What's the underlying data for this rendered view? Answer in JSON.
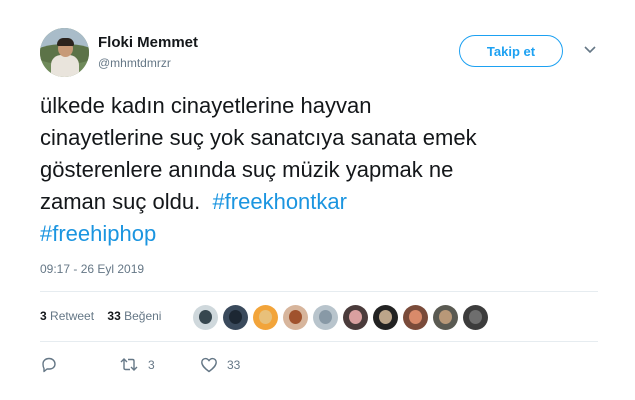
{
  "user": {
    "name": "Floki Memmet",
    "handle": "@mhmtdmrzr"
  },
  "follow_button": {
    "label": "Takip et"
  },
  "tweet": {
    "text_lines": [
      "ülkede kadın cinayetlerine hayvan",
      "cinayetlerine suç yok sanatcıya sanata emek",
      "gösterenlere anında suç müzik yapmak ne",
      "zaman suç oldu. "
    ],
    "hashtags": [
      "#freekhontkar",
      "#freehiphop"
    ],
    "timestamp": "09:17 - 26 Eyl 2019"
  },
  "stats": {
    "retweet_count": "3",
    "retweet_label": "Retweet",
    "like_count": "33",
    "like_label": "Beğeni"
  },
  "likers": [
    {
      "color": "#cfd8dc",
      "face": "#37474f"
    },
    {
      "color": "#3a4a5c",
      "face": "#1c2733"
    },
    {
      "color": "#f2a43a",
      "face": "#e8c07a"
    },
    {
      "color": "#d7b59c",
      "face": "#a0522d"
    },
    {
      "color": "#b8c4cc",
      "face": "#8899a6"
    },
    {
      "color": "#4a3b3b",
      "face": "#d9a0a0"
    },
    {
      "color": "#222222",
      "face": "#bca58a"
    },
    {
      "color": "#7a4b3a",
      "face": "#d98a6a"
    },
    {
      "color": "#5a5a52",
      "face": "#b89878"
    },
    {
      "color": "#3c3c3c",
      "face": "#6e6e6e"
    }
  ],
  "actions": {
    "reply_count": "",
    "retweet_count": "3",
    "like_count": "33"
  },
  "colors": {
    "accent": "#1da1f2",
    "hashtag": "#1b95e0",
    "muted": "#657786"
  }
}
